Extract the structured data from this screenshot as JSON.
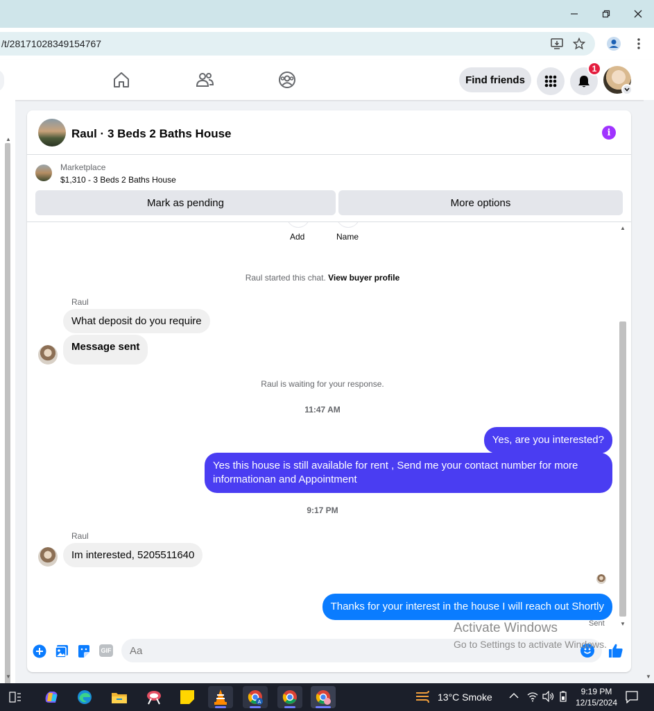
{
  "browser": {
    "url": "/t/28171028349154767"
  },
  "nav": {
    "find_friends": "Find friends",
    "notification_count": "1"
  },
  "chat": {
    "title": "Raul · 3 Beds 2 Baths House",
    "marketplace_label": "Marketplace",
    "listing": "$1,310 - 3 Beds 2 Baths House",
    "mark_pending": "Mark as pending",
    "more_options": "More options",
    "top_actions": [
      "Add",
      "Name"
    ],
    "started_text": "Raul started this chat.",
    "view_buyer": "View buyer profile",
    "messages": {
      "sender1": "Raul",
      "m1": "What deposit do you require",
      "m2": "Message sent",
      "waiting": "Raul is waiting for your response.",
      "time1": "11:47 AM",
      "out1": "Yes, are you interested?",
      "out2": "Yes this house is still available for rent , Send me your contact number for more informationan and Appointment",
      "time2": "9:17 PM",
      "sender2": "Raul",
      "m3": "Im interested, 5205511640",
      "out3": "Thanks for your interest in the house I will reach out Shortly",
      "sent": "Sent"
    },
    "composer_placeholder": "Aa",
    "gif_label": "GIF"
  },
  "watermark": {
    "line1": "Activate Windows",
    "line2": "Go to Settings to activate Windows."
  },
  "taskbar": {
    "weather": "13°C  Smoke",
    "time": "9:19 PM",
    "date": "12/15/2024"
  },
  "colors": {
    "accent_blue": "#0a7cff",
    "accent_purple": "#4a3df2",
    "info_purple": "#a033ff",
    "badge_red": "#e41e3f"
  }
}
